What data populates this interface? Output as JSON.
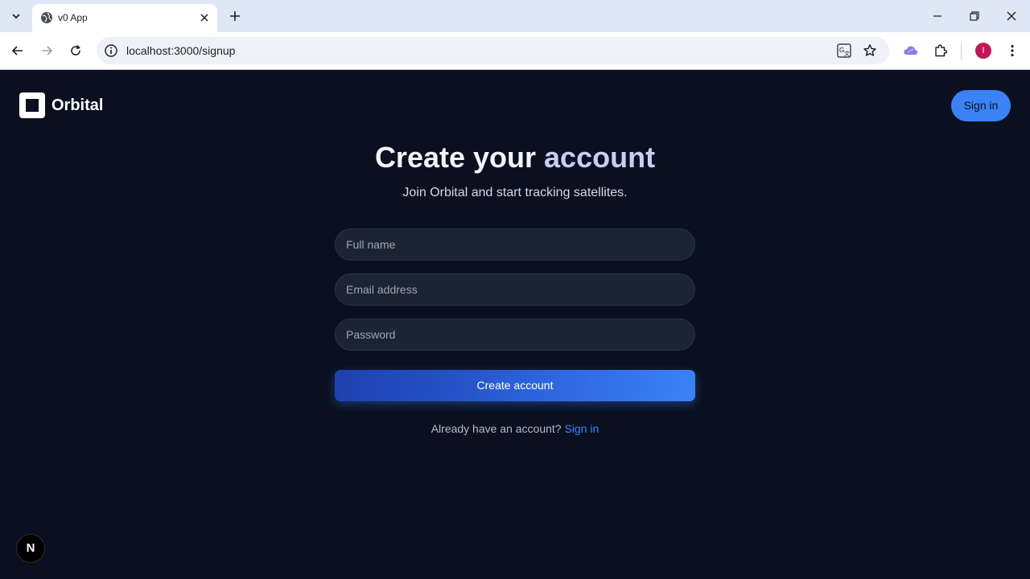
{
  "browser": {
    "tab_title": "v0 App",
    "url": "localhost:3000/signup",
    "profile_initial": "I"
  },
  "header": {
    "brand": "Orbital",
    "signin_label": "Sign in"
  },
  "main": {
    "heading_part1": "Create your",
    "heading_part2": "account",
    "subtitle": "Join Orbital and start tracking satellites.",
    "fields": {
      "full_name_placeholder": "Full name",
      "email_placeholder": "Email address",
      "password_placeholder": "Password"
    },
    "submit_label": "Create account",
    "footer_text": "Already have an account?",
    "footer_link": "Sign in"
  },
  "dev_badge": "N",
  "colors": {
    "background": "#0a1020",
    "accent": "#3b82f6",
    "field_bg": "#1c2432"
  }
}
